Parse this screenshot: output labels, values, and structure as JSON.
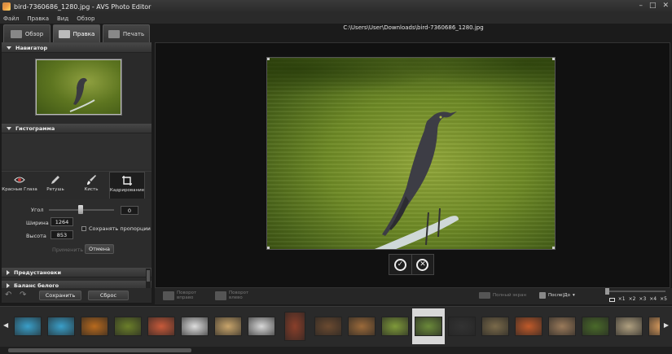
{
  "window": {
    "title": "bird-7360686_1280.jpg - AVS Photo Editor",
    "controls": [
      "–",
      "□",
      "✕"
    ]
  },
  "menu": [
    "Файл",
    "Правка",
    "Вид",
    "Обзор"
  ],
  "tabs": [
    {
      "label": "Обзор",
      "icon": "browse-icon",
      "active": false
    },
    {
      "label": "Правка",
      "icon": "edit-brush-icon",
      "active": true
    },
    {
      "label": "Печать",
      "icon": "printer-icon",
      "active": false
    }
  ],
  "file_path": "C:\\Users\\User\\Downloads\\bird-7360686_1280.jpg",
  "sidebar": {
    "navigator_header": "Навигатор",
    "histogram_header": "Гистограмма",
    "tools": [
      {
        "label": "Красные Глаза",
        "icon": "red-eye-icon",
        "active": false
      },
      {
        "label": "Ретушь",
        "icon": "retouch-icon",
        "active": false
      },
      {
        "label": "Кисть",
        "icon": "brush-icon",
        "active": false
      },
      {
        "label": "Кадрирование",
        "icon": "crop-icon",
        "active": true
      }
    ],
    "crop": {
      "angle_label": "Угол",
      "angle_value": "0",
      "width_label": "Ширина",
      "width_value": "1264",
      "height_label": "Высота",
      "height_value": "853",
      "keep_proportions_label": "Сохранять пропорции",
      "keep_proportions_checked": false,
      "apply_label": "Применить",
      "cancel_label": "Отмена"
    },
    "presets_header": "Предустановки",
    "white_balance_header": "Баланс белого",
    "save_label": "Сохранить",
    "reset_label": "Сброс"
  },
  "toolbar": {
    "rotate_right_label": "Поворот вправо",
    "rotate_left_label": "Поворот влево",
    "fullscreen_label": "Полный экран",
    "before_after_label": "После|До",
    "zoom_options": [
      "×1",
      "×2",
      "×3",
      "×4",
      "×5"
    ]
  },
  "filmstrip": {
    "thumb_colors": [
      "#3a9fc9",
      "#3a9fc9",
      "#b86a1e",
      "#6b7f2a",
      "#c85a3a",
      "#dddddd",
      "#c9a56b",
      "#d8d8d8",
      "#8a3f2a",
      "#6b4a30",
      "#9b6a3a",
      "#7f9a3a",
      "#6b8a3a",
      "#333333",
      "#7a6a4a",
      "#c05a2a",
      "#9a7a5a",
      "#4a6a2a",
      "#b0a080",
      "#e0a060",
      "#c09060"
    ],
    "selected_index": 12
  }
}
